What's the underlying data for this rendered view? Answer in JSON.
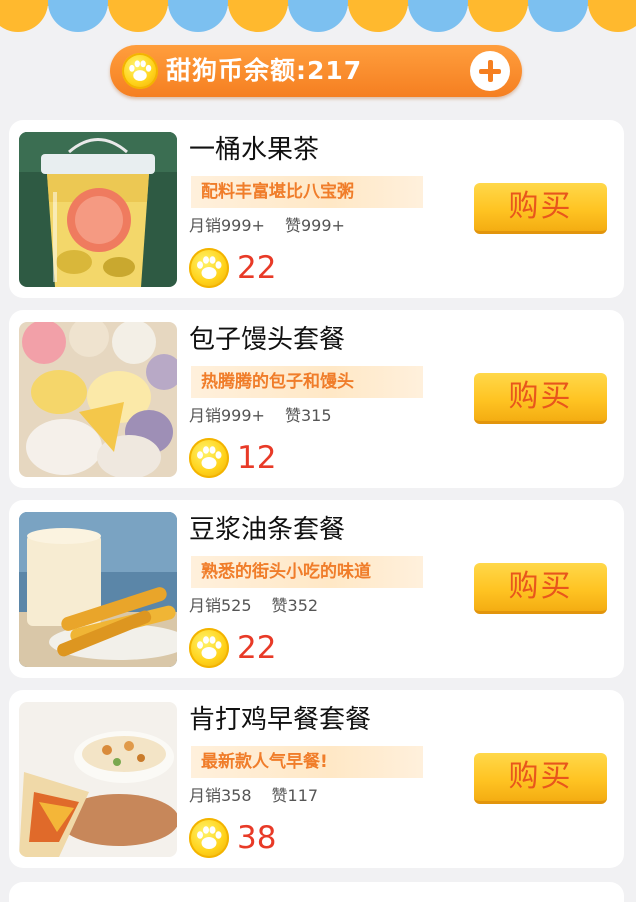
{
  "header": {
    "balance_label": "甜狗币余额:217",
    "add_icon": "plus-icon",
    "coin_icon": "paw-coin-icon",
    "colors": {
      "pill": "#f57f21",
      "scallop_yellow": "#ffb92e",
      "scallop_blue": "#7cc0f0"
    }
  },
  "products": [
    {
      "title": "一桶水果茶",
      "slogan": "配料丰富堪比八宝粥",
      "monthly_sales": "月销999+",
      "likes": "赞999+",
      "price": "22",
      "buy_label": "购买",
      "image": "fruit-tea-bucket"
    },
    {
      "title": "包子馒头套餐",
      "slogan": "热腾腾的包子和馒头",
      "monthly_sales": "月销999+",
      "likes": "赞315",
      "price": "12",
      "buy_label": "购买",
      "image": "buns-and-mantou"
    },
    {
      "title": "豆浆油条套餐",
      "slogan": "熟悉的街头小吃的味道",
      "monthly_sales": "月销525",
      "likes": "赞352",
      "price": "22",
      "buy_label": "购买",
      "image": "soymilk-and-youtiao"
    },
    {
      "title": "肯打鸡早餐套餐",
      "slogan": "最新款人气早餐!",
      "monthly_sales": "月销358",
      "likes": "赞117",
      "price": "38",
      "buy_label": "购买",
      "image": "breakfast-wrap-and-porridge"
    }
  ],
  "colors": {
    "price": "#e83a27",
    "buy_button": "#ffc423",
    "buy_text": "#e8561c",
    "slogan_text": "#f07d2a"
  }
}
